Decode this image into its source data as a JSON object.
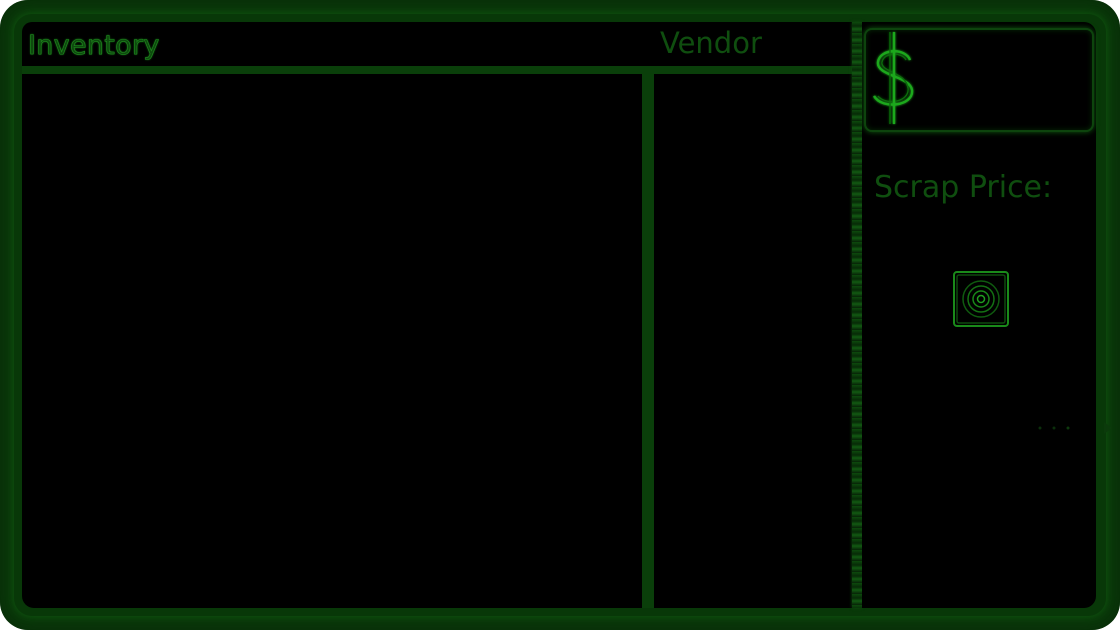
{
  "inventory": {
    "title": "Inventory",
    "vendor_title": "Vendor"
  },
  "side": {
    "currency_icon": "dollar-icon",
    "money_value": "",
    "scrap_price_label": "Scrap Price:",
    "scrap_icon": "target-icon"
  },
  "colors": {
    "frame": "#0b3a0b",
    "panel": "#000000",
    "text": "#0f4e0f",
    "glow": "#1e8a1e"
  }
}
